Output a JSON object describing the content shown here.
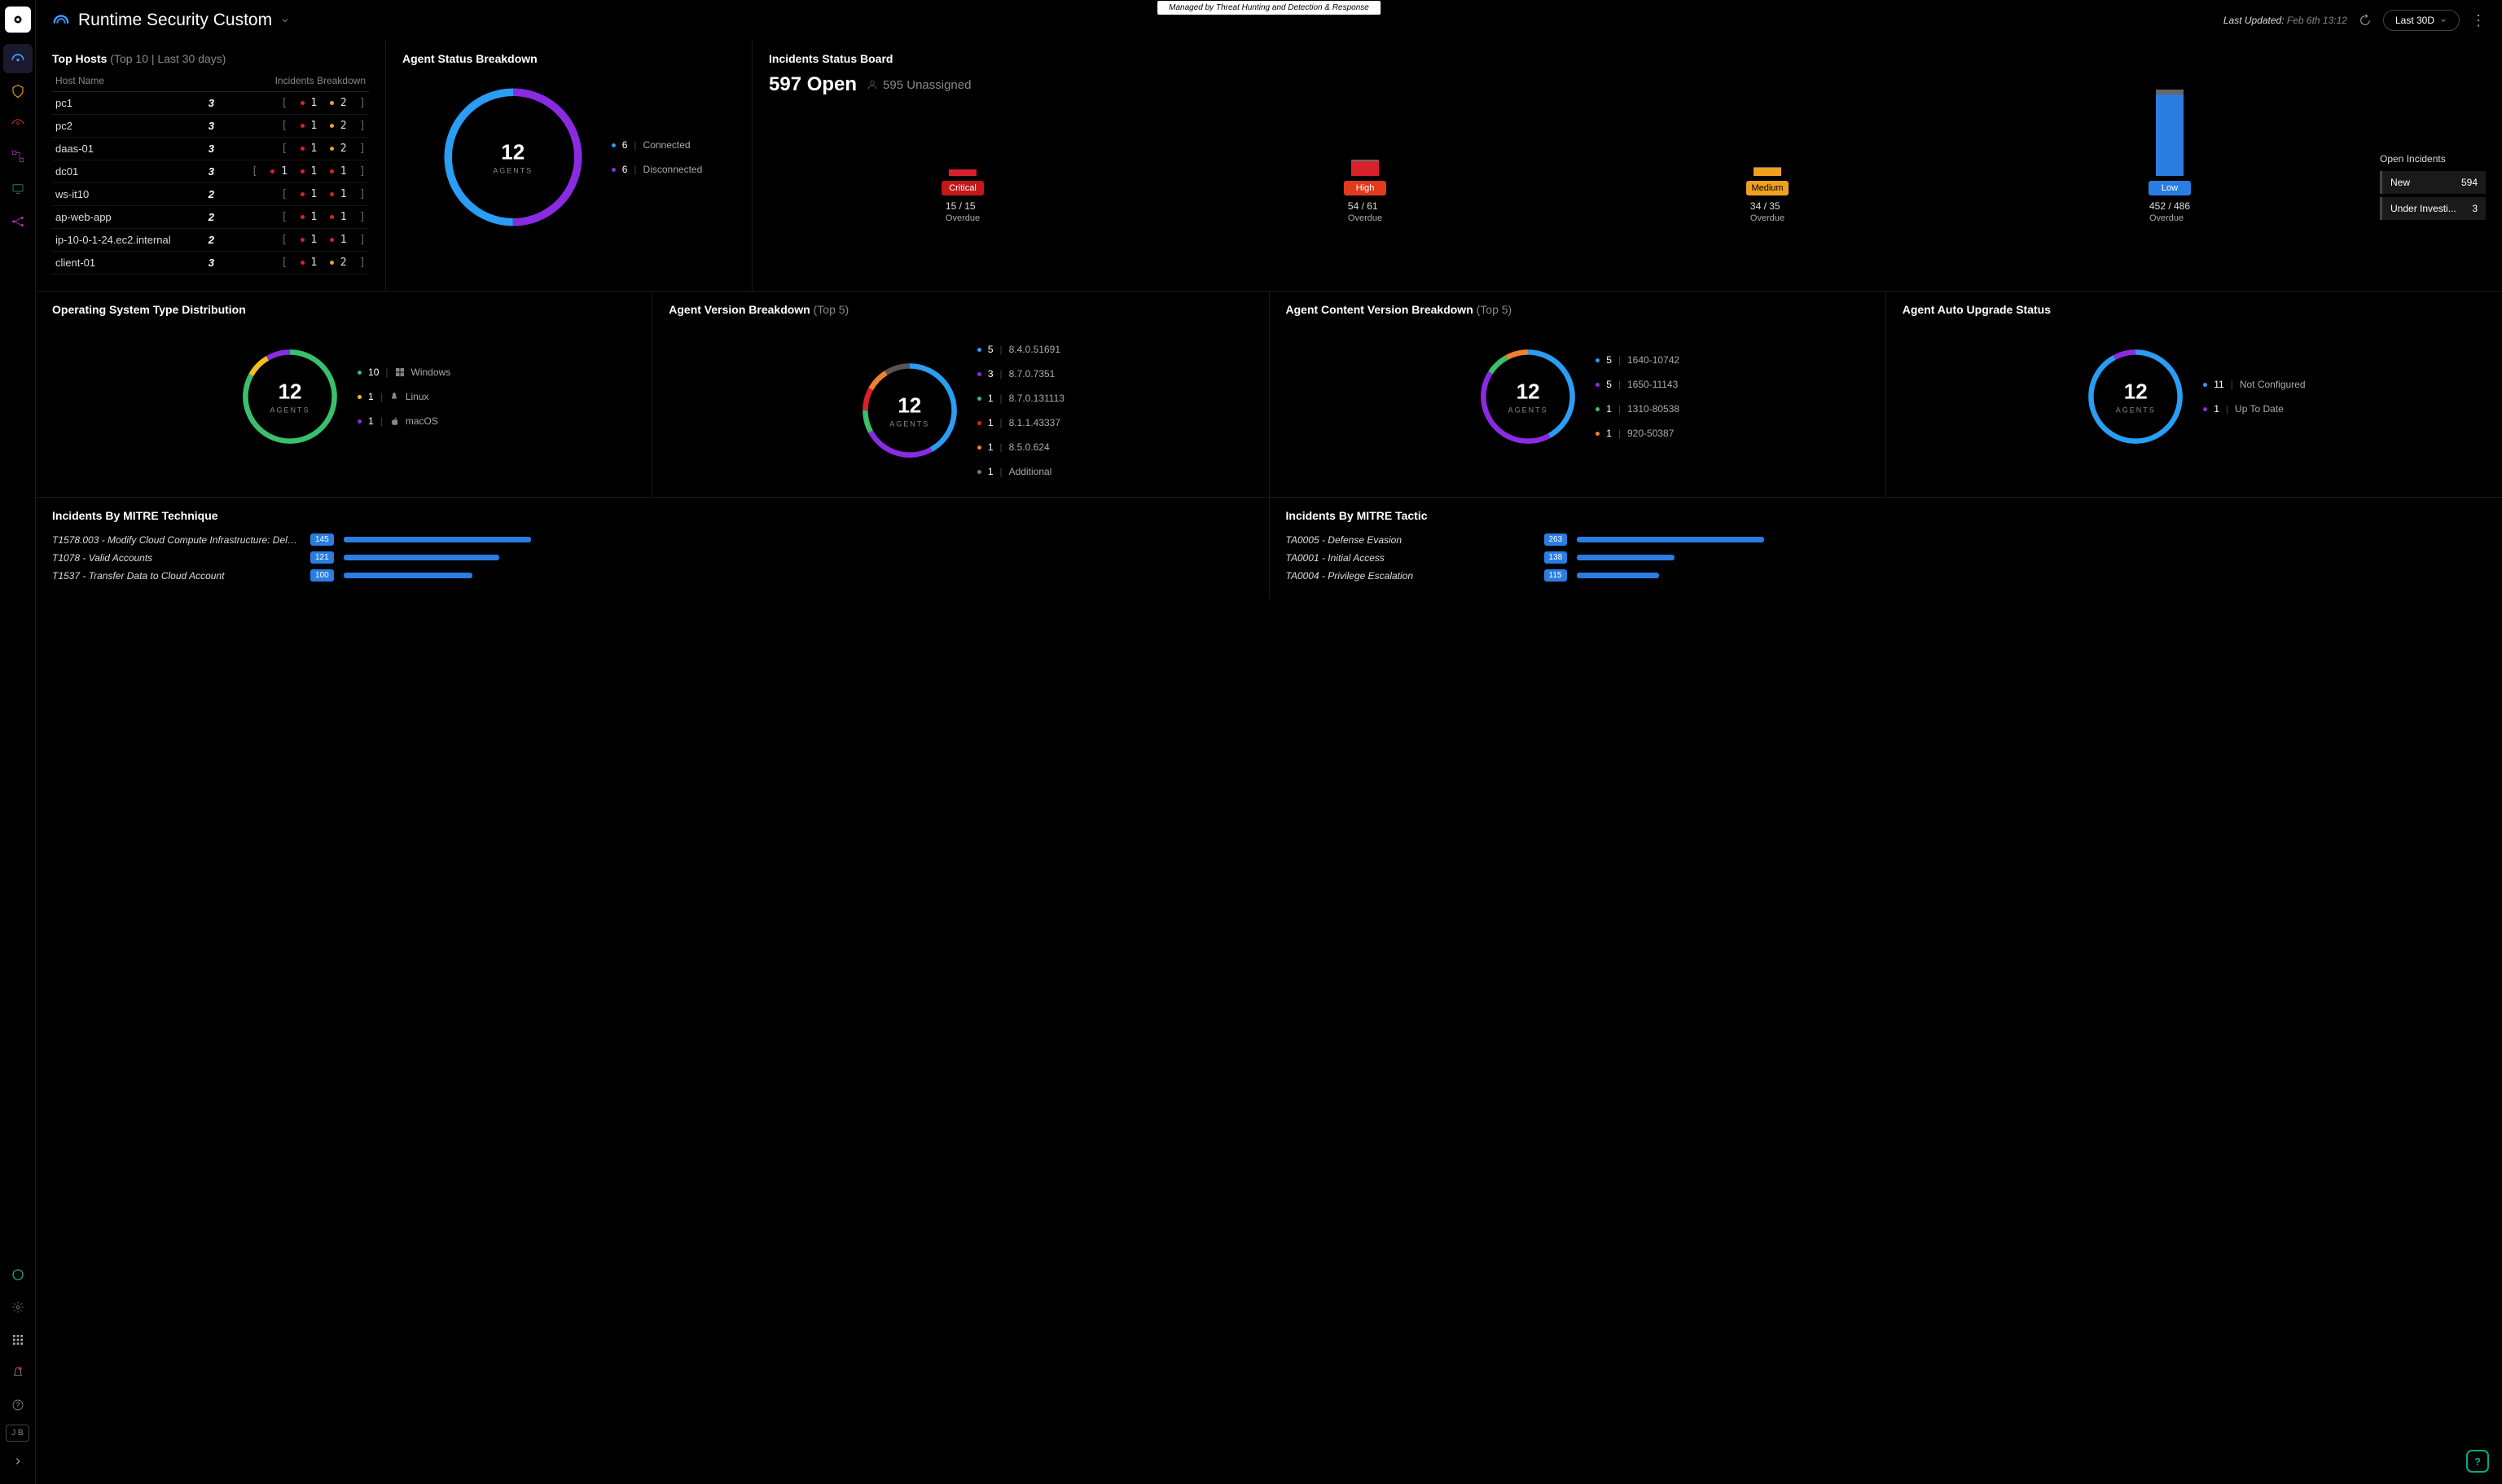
{
  "header": {
    "title": "Runtime Security Custom",
    "managed_by": "Managed by Threat Hunting and Detection & Response",
    "last_updated_label": "Last Updated:",
    "last_updated_value": "Feb 6th 13:12",
    "time_range": "Last 30D"
  },
  "sidebar": {
    "user_initials": "J B"
  },
  "top_hosts": {
    "title": "Top Hosts",
    "subtitle": "(Top 10 | Last 30 days)",
    "col_host": "Host Name",
    "col_incidents": "Incidents Breakdown",
    "rows": [
      {
        "host": "pc1",
        "count": "3",
        "segs": [
          [
            "crit",
            "1"
          ],
          [
            "med",
            "2"
          ]
        ]
      },
      {
        "host": "pc2",
        "count": "3",
        "segs": [
          [
            "crit",
            "1"
          ],
          [
            "med",
            "2"
          ]
        ]
      },
      {
        "host": "daas-01",
        "count": "3",
        "segs": [
          [
            "crit",
            "1"
          ],
          [
            "med",
            "2"
          ]
        ]
      },
      {
        "host": "dc01",
        "count": "3",
        "segs": [
          [
            "crit",
            "1"
          ],
          [
            "crit",
            "1"
          ],
          [
            "crit",
            "1"
          ]
        ]
      },
      {
        "host": "ws-it10",
        "count": "2",
        "segs": [
          [
            "crit",
            "1"
          ],
          [
            "crit",
            "1"
          ]
        ]
      },
      {
        "host": "ap-web-app",
        "count": "2",
        "segs": [
          [
            "crit",
            "1"
          ],
          [
            "crit",
            "1"
          ]
        ]
      },
      {
        "host": "ip-10-0-1-24.ec2.internal",
        "count": "2",
        "segs": [
          [
            "crit",
            "1"
          ],
          [
            "crit",
            "1"
          ]
        ]
      },
      {
        "host": "client-01",
        "count": "3",
        "segs": [
          [
            "crit",
            "1"
          ],
          [
            "med",
            "2"
          ]
        ]
      }
    ]
  },
  "agent_status": {
    "title": "Agent Status Breakdown",
    "total": "12",
    "unit": "AGENTS",
    "legend": [
      {
        "color": "#2a9df4",
        "count": "6",
        "label": "Connected"
      },
      {
        "color": "#8a2be2",
        "count": "6",
        "label": "Disconnected"
      }
    ]
  },
  "status_board": {
    "title": "Incidents Status Board",
    "open_count": "597 Open",
    "unassigned": "595 Unassigned",
    "bars": [
      {
        "label": "Critical",
        "cls": "critical",
        "overdue": "15 / 15",
        "h": 8,
        "top": 0
      },
      {
        "label": "High",
        "cls": "high",
        "overdue": "54 / 61",
        "h": 18,
        "top": 2
      },
      {
        "label": "Medium",
        "cls": "medium",
        "overdue": "34 / 35",
        "h": 10,
        "top": 1
      },
      {
        "label": "Low",
        "cls": "low",
        "overdue": "452 / 486",
        "h": 100,
        "top": 6
      }
    ],
    "overdue_label": "Overdue",
    "open_incidents": {
      "title": "Open Incidents",
      "rows": [
        {
          "label": "New",
          "value": "594"
        },
        {
          "label": "Under Investi...",
          "value": "3"
        }
      ]
    }
  },
  "os_dist": {
    "title": "Operating System Type Distribution",
    "total": "12",
    "unit": "AGENTS",
    "segments": [
      {
        "color": "#39c06b",
        "pct": 83
      },
      {
        "color": "#f0c020",
        "pct": 8.5
      },
      {
        "color": "#8a2be2",
        "pct": 8.5
      }
    ],
    "legend": [
      {
        "color": "#39c06b",
        "count": "10",
        "icon": "win",
        "label": "Windows"
      },
      {
        "color": "#f0c020",
        "count": "1",
        "icon": "linux",
        "label": "Linux"
      },
      {
        "color": "#8a2be2",
        "count": "1",
        "icon": "apple",
        "label": "macOS"
      }
    ]
  },
  "agent_version": {
    "title": "Agent Version Breakdown",
    "subtitle": "(Top 5)",
    "total": "12",
    "unit": "AGENTS",
    "segments": [
      {
        "color": "#2a9df4",
        "pct": 42
      },
      {
        "color": "#8a2be2",
        "pct": 25
      },
      {
        "color": "#39c06b",
        "pct": 8
      },
      {
        "color": "#d9212b",
        "pct": 8
      },
      {
        "color": "#f08030",
        "pct": 8
      },
      {
        "color": "#555",
        "pct": 9
      }
    ],
    "legend": [
      {
        "color": "#2a9df4",
        "count": "5",
        "label": "8.4.0.51691"
      },
      {
        "color": "#8a2be2",
        "count": "3",
        "label": "8.7.0.7351"
      },
      {
        "color": "#39c06b",
        "count": "1",
        "label": "8.7.0.131113"
      },
      {
        "color": "#d9212b",
        "count": "1",
        "label": "8.1.1.43337"
      },
      {
        "color": "#f08030",
        "count": "1",
        "label": "8.5.0.624"
      },
      {
        "color": "#777",
        "count": "1",
        "label": "Additional"
      }
    ]
  },
  "content_version": {
    "title": "Agent Content Version Breakdown",
    "subtitle": "(Top 5)",
    "total": "12",
    "unit": "AGENTS",
    "segments": [
      {
        "color": "#2a9df4",
        "pct": 42
      },
      {
        "color": "#8a2be2",
        "pct": 42
      },
      {
        "color": "#39c06b",
        "pct": 8
      },
      {
        "color": "#f08030",
        "pct": 8
      }
    ],
    "legend": [
      {
        "color": "#2a9df4",
        "count": "5",
        "label": "1640-10742"
      },
      {
        "color": "#8a2be2",
        "count": "5",
        "label": "1650-11143"
      },
      {
        "color": "#39c06b",
        "count": "1",
        "label": "1310-80538"
      },
      {
        "color": "#f08030",
        "count": "1",
        "label": "920-50387"
      }
    ]
  },
  "auto_upgrade": {
    "title": "Agent Auto Upgrade Status",
    "total": "12",
    "unit": "AGENTS",
    "segments": [
      {
        "color": "#2a9df4",
        "pct": 92
      },
      {
        "color": "#8a2be2",
        "pct": 8
      }
    ],
    "legend": [
      {
        "color": "#2a9df4",
        "count": "11",
        "label": "Not Configured"
      },
      {
        "color": "#8a2be2",
        "count": "1",
        "label": "Up To Date"
      }
    ]
  },
  "mitre_technique": {
    "title": "Incidents By MITRE Technique",
    "rows": [
      {
        "label": "T1578.003 - Modify Cloud Compute Infrastructure: Delete Cl...",
        "count": "145",
        "w": 100
      },
      {
        "label": "T1078 - Valid Accounts",
        "count": "121",
        "w": 83
      },
      {
        "label": "T1537 - Transfer Data to Cloud Account",
        "count": "100",
        "w": 69
      }
    ]
  },
  "mitre_tactic": {
    "title": "Incidents By MITRE Tactic",
    "rows": [
      {
        "label": "TA0005 - Defense Evasion",
        "count": "263",
        "w": 100
      },
      {
        "label": "TA0001 - Initial Access",
        "count": "138",
        "w": 52
      },
      {
        "label": "TA0004 - Privilege Escalation",
        "count": "115",
        "w": 44
      }
    ]
  },
  "chart_data": [
    {
      "type": "donut",
      "title": "Agent Status Breakdown",
      "total": 12,
      "series": [
        {
          "name": "Connected",
          "value": 6
        },
        {
          "name": "Disconnected",
          "value": 6
        }
      ]
    },
    {
      "type": "bar",
      "title": "Incidents Status Board",
      "categories": [
        "Critical",
        "High",
        "Medium",
        "Low"
      ],
      "series": [
        {
          "name": "Overdue",
          "values": [
            15,
            54,
            34,
            452
          ]
        },
        {
          "name": "Total",
          "values": [
            15,
            61,
            35,
            486
          ]
        }
      ]
    },
    {
      "type": "donut",
      "title": "Operating System Type Distribution",
      "total": 12,
      "series": [
        {
          "name": "Windows",
          "value": 10
        },
        {
          "name": "Linux",
          "value": 1
        },
        {
          "name": "macOS",
          "value": 1
        }
      ]
    },
    {
      "type": "donut",
      "title": "Agent Version Breakdown (Top 5)",
      "total": 12,
      "series": [
        {
          "name": "8.4.0.51691",
          "value": 5
        },
        {
          "name": "8.7.0.7351",
          "value": 3
        },
        {
          "name": "8.7.0.131113",
          "value": 1
        },
        {
          "name": "8.1.1.43337",
          "value": 1
        },
        {
          "name": "8.5.0.624",
          "value": 1
        },
        {
          "name": "Additional",
          "value": 1
        }
      ]
    },
    {
      "type": "donut",
      "title": "Agent Content Version Breakdown (Top 5)",
      "total": 12,
      "series": [
        {
          "name": "1640-10742",
          "value": 5
        },
        {
          "name": "1650-11143",
          "value": 5
        },
        {
          "name": "1310-80538",
          "value": 1
        },
        {
          "name": "920-50387",
          "value": 1
        }
      ]
    },
    {
      "type": "donut",
      "title": "Agent Auto Upgrade Status",
      "total": 12,
      "series": [
        {
          "name": "Not Configured",
          "value": 11
        },
        {
          "name": "Up To Date",
          "value": 1
        }
      ]
    },
    {
      "type": "bar",
      "title": "Incidents By MITRE Technique",
      "categories": [
        "T1578.003",
        "T1078",
        "T1537"
      ],
      "values": [
        145,
        121,
        100
      ]
    },
    {
      "type": "bar",
      "title": "Incidents By MITRE Tactic",
      "categories": [
        "TA0005",
        "TA0001",
        "TA0004"
      ],
      "values": [
        263,
        138,
        115
      ]
    }
  ]
}
